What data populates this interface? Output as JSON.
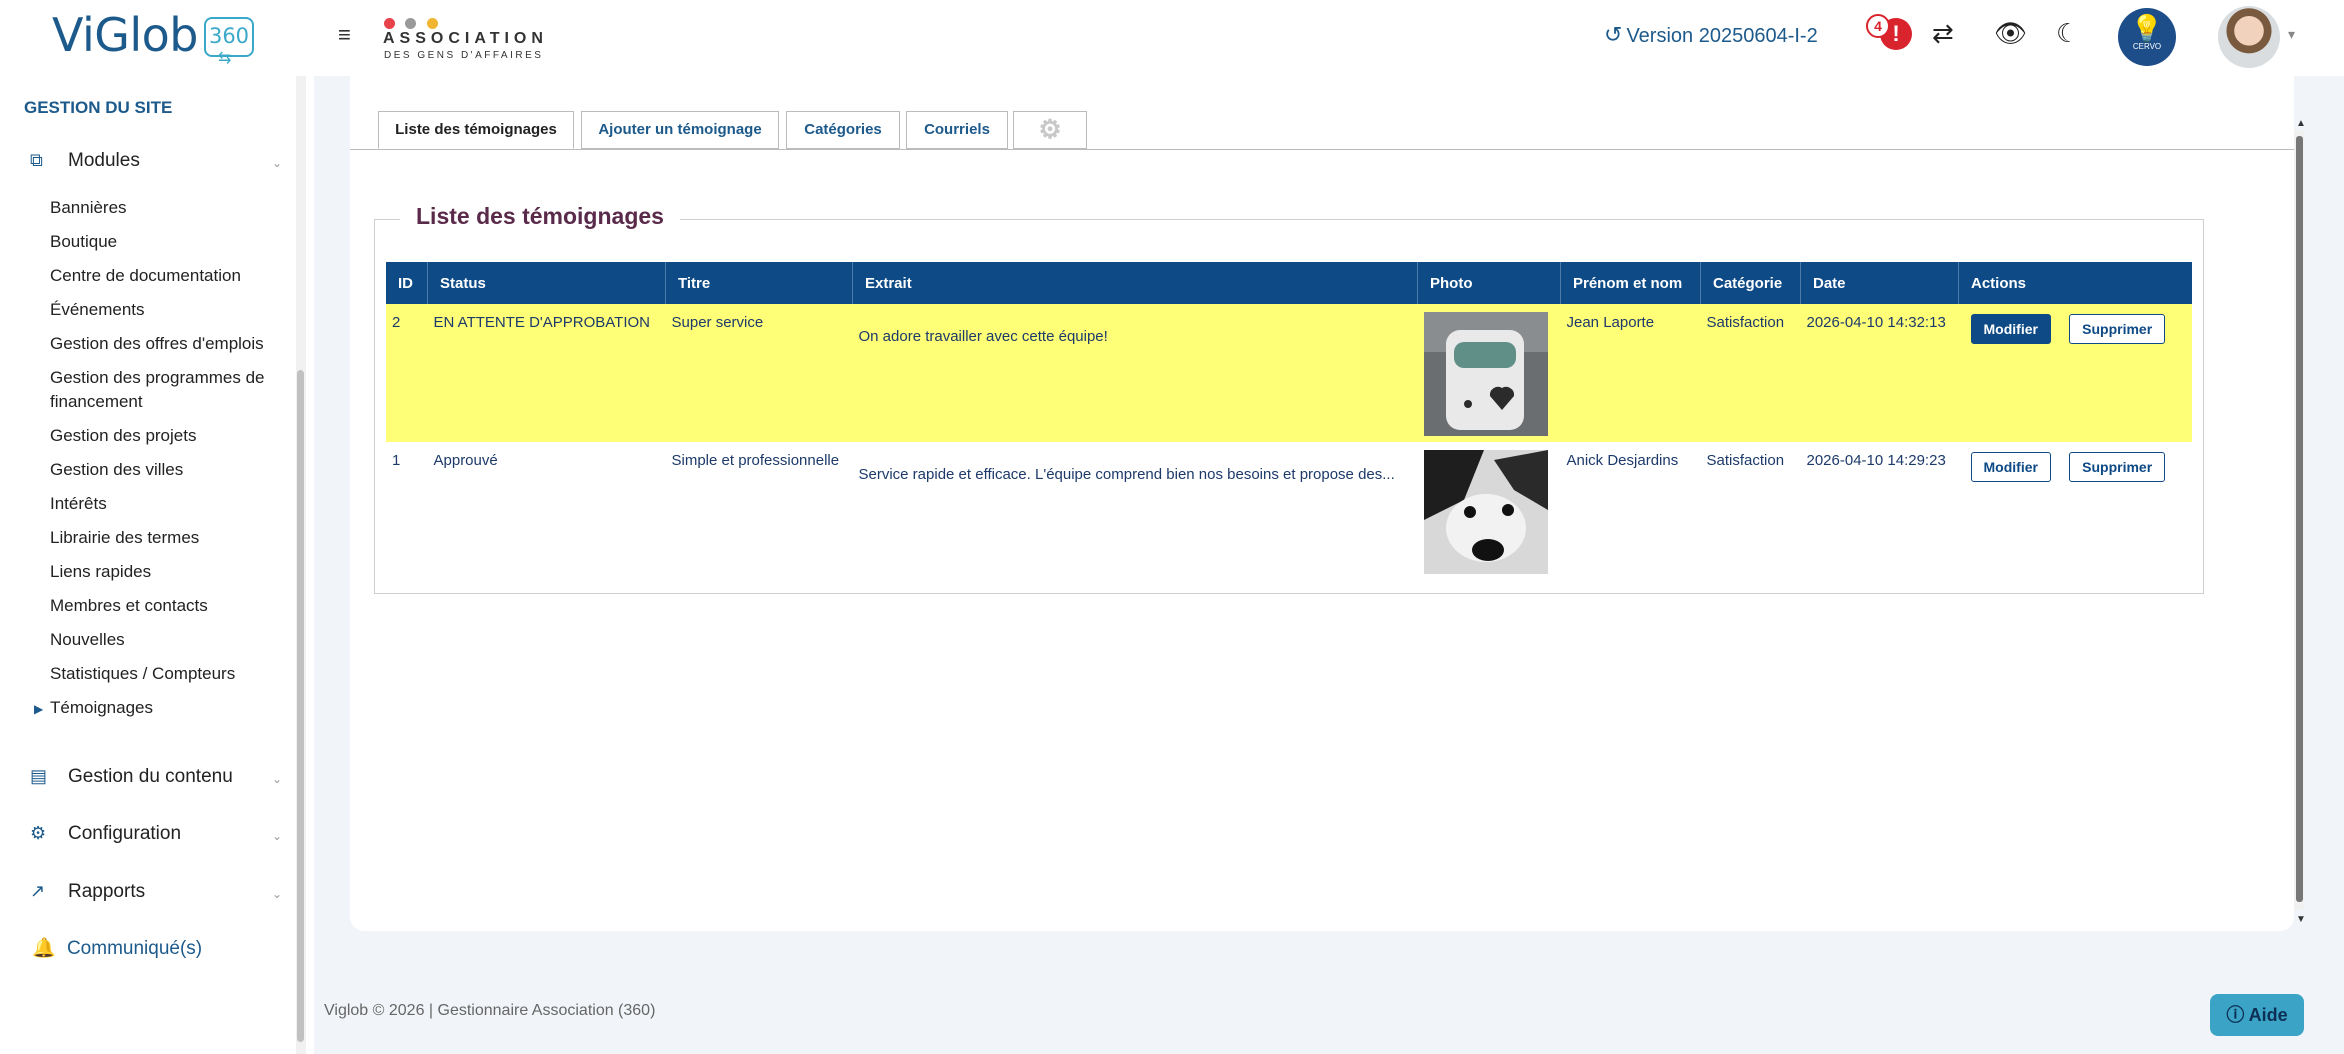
{
  "header": {
    "logo_text": "ViGlob",
    "logo_badge": "360",
    "org_name": "ASSOCIATION",
    "org_sub": "DES GENS D'AFFAIRES",
    "version": "Version 20250604-I-2",
    "alert_count": "4",
    "cervo_label": "CERVO"
  },
  "sidebar": {
    "title": "GESTION DU SITE",
    "modules_label": "Modules",
    "items": [
      "Bannières",
      "Boutique",
      "Centre de documentation",
      "Événements",
      "Gestion des offres d'emplois",
      "Gestion des programmes de financement",
      "Gestion des projets",
      "Gestion des villes",
      "Intérêts",
      "Librairie des termes",
      "Liens rapides",
      "Membres et contacts",
      "Nouvelles",
      "Statistiques / Compteurs",
      "Témoignages"
    ],
    "content_label": "Gestion du contenu",
    "config_label": "Configuration",
    "reports_label": "Rapports",
    "communique_label": "Communiqué(s)"
  },
  "tabs": {
    "list": "Liste des témoignages",
    "add": "Ajouter un témoignage",
    "categories": "Catégories",
    "emails": "Courriels"
  },
  "section_title": "Liste des témoignages",
  "table": {
    "headers": [
      "ID",
      "Status",
      "Titre",
      "Extrait",
      "Photo",
      "Prénom et nom",
      "Catégorie",
      "Date",
      "Actions"
    ],
    "rows": [
      {
        "id": "2",
        "status": "EN ATTENTE D'APPROBATION",
        "title": "Super service",
        "excerpt": "On adore travailler avec cette équipe!",
        "name": "Jean Laporte",
        "category": "Satisfaction",
        "date": "2026-04-10 14:32:13",
        "edit": "Modifier",
        "delete": "Supprimer"
      },
      {
        "id": "1",
        "status": "Approuvé",
        "title": "Simple et professionnelle",
        "excerpt": "Service rapide et efficace. L'équipe comprend bien nos besoins et propose des...",
        "name": "Anick Desjardins",
        "category": "Satisfaction",
        "date": "2026-04-10 14:29:23",
        "edit": "Modifier",
        "delete": "Supprimer"
      }
    ]
  },
  "footer": "Viglob © 2026 | Gestionnaire Association (360)",
  "help_label": "Aide",
  "colors": {
    "primary": "#0e4a86",
    "brand": "#1d5a8c",
    "pending_row": "#ffff77",
    "alert": "#d9232d",
    "help": "#3aa3c6"
  }
}
